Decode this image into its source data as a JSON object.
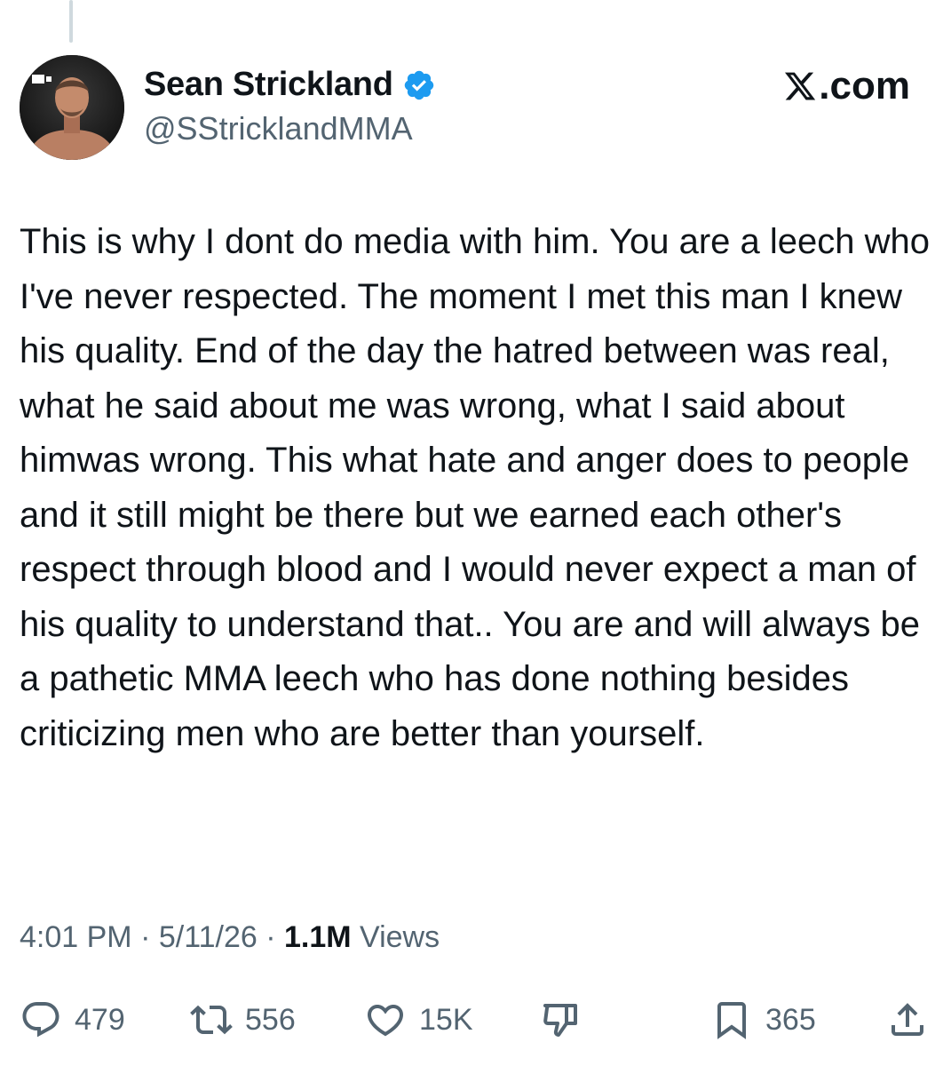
{
  "author": {
    "display_name": "Sean Strickland",
    "handle": "@SStricklandMMA",
    "verified": true
  },
  "site_label": ".com",
  "tweet": {
    "text": "This is why I dont do media with him. You are a leech who I've never respected. The moment I met this man I knew his quality. End of the day the hatred between was real, what he said about me was wrong, what I said about himwas wrong. This what hate and anger does to people and it still might be there but we earned each other's respect through blood and I would never expect a man of his quality to understand that.. You are and will always be a pathetic MMA leech who has done nothing besides criticizing men who are better than yourself."
  },
  "meta": {
    "time": "4:01 PM",
    "separator": " · ",
    "date": "5/11/26",
    "views_count": "1.1M",
    "views_label": " Views"
  },
  "actions": {
    "replies": "479",
    "reposts": "556",
    "likes": "15K",
    "bookmarks": "365"
  },
  "colors": {
    "verified_blue": "#1d9bf0",
    "text_primary": "#0f1419",
    "text_secondary": "#536471"
  },
  "icons": [
    "verified-badge-icon",
    "x-logo-icon",
    "reply-icon",
    "repost-icon",
    "like-icon",
    "downvote-icon",
    "bookmark-icon",
    "share-icon"
  ]
}
